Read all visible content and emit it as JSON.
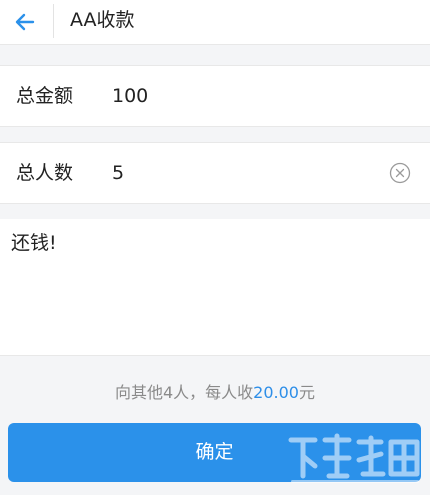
{
  "header": {
    "title": "AA收款",
    "back_icon": "arrow-left-icon"
  },
  "form": {
    "total_amount": {
      "label": "总金额",
      "value": "100"
    },
    "total_people": {
      "label": "总人数",
      "value": "5",
      "clear_icon": "clear-circle-icon"
    },
    "memo": {
      "value": "还钱!"
    }
  },
  "summary": {
    "prefix": "向其他4人，每人收",
    "amount": "20.00",
    "suffix": "元"
  },
  "confirm_button": {
    "label": "确定"
  },
  "colors": {
    "accent": "#2b91ea",
    "background": "#f4f5f7",
    "surface": "#ffffff"
  }
}
